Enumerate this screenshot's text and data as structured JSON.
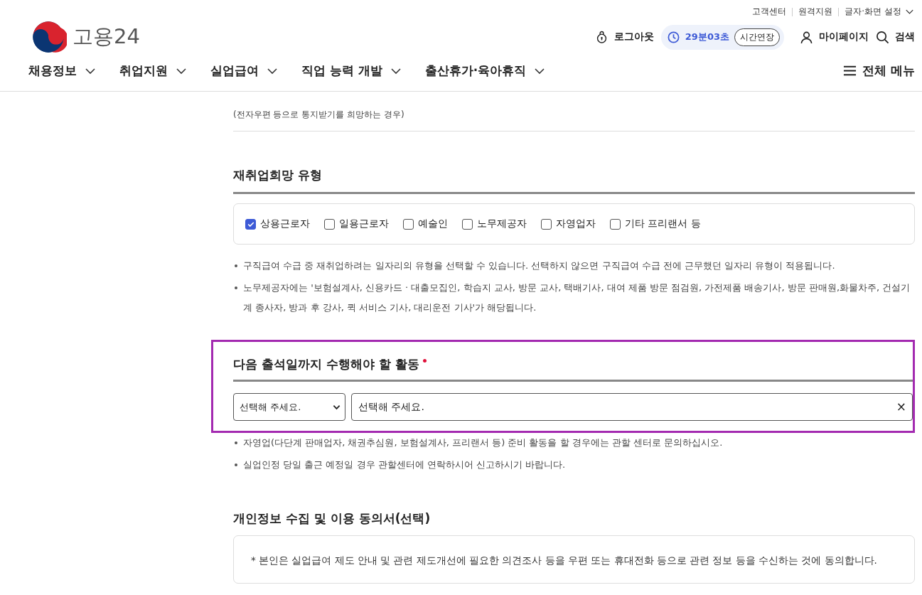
{
  "utility_links": [
    {
      "label": "고객센터"
    },
    {
      "label": "원격지원"
    },
    {
      "label": "글자·화면 설정",
      "dropdown": true
    }
  ],
  "logo": {
    "text": "고용24"
  },
  "session": {
    "logout": "로그아웃",
    "timer": "29분03초",
    "extend": "시간연장",
    "mypage": "마이페이지",
    "search": "검색"
  },
  "nav": {
    "items": [
      {
        "label": "채용정보"
      },
      {
        "label": "취업지원"
      },
      {
        "label": "실업급여"
      },
      {
        "label": "직업 능력 개발"
      },
      {
        "label": "출산휴가·육아휴직"
      }
    ],
    "all_menu": "전체 메뉴"
  },
  "notice_method": {
    "hint": "(전자우편 등으로 통지받기를 희망하는 경우)"
  },
  "job_type": {
    "title": "재취업희망 유형",
    "options": [
      {
        "label": "상용근로자",
        "checked": true
      },
      {
        "label": "일용근로자",
        "checked": false
      },
      {
        "label": "예술인",
        "checked": false
      },
      {
        "label": "노무제공자",
        "checked": false
      },
      {
        "label": "자영업자",
        "checked": false
      },
      {
        "label": "기타 프리랜서 등",
        "checked": false
      }
    ],
    "notes": [
      "구직급여 수급 중 재취업하려는 일자리의 유형을 선택할 수 있습니다. 선택하지 않으면 구직급여 수급 전에 근무했던 일자리 유형이 적용됩니다.",
      "노무제공자에는 '보험설계사, 신용카드 · 대출모집인, 학습지 교사, 방문 교사, 택배기사, 대여 제품 방문 점검원, 가전제품 배송기사, 방문 판매원,화물차주, 건설기계 종사자, 방과 후 강사, 퀵 서비스 기사, 대리운전 기사'가 해당됩니다."
    ]
  },
  "activity": {
    "title": "다음 출석일까지 수행해야 할 활동",
    "required": true,
    "highlighted": true,
    "select": {
      "value": "선택해 주세요."
    },
    "field": {
      "value": "선택해 주세요."
    },
    "clear": "×",
    "notes": [
      "자영업(다단계 판매업자, 채권추심원, 보험설계사, 프리랜서 등) 준비 활동을 할 경우에는 관할 센터로 문의하십시오.",
      "실업인정 당일 출근 예정일 경우 관할센터에 연락하시어 신고하시기 바랍니다."
    ]
  },
  "consent": {
    "title": "개인정보 수집 및 이용 동의서(선택)",
    "text": "* 본인은 실업급여 제도 안내 및 관련 제도개선에 필요한 의견조사 등을 우편 또는 휴대전화 등으로 관련 정보 등을 수신하는 것에 동의합니다."
  }
}
